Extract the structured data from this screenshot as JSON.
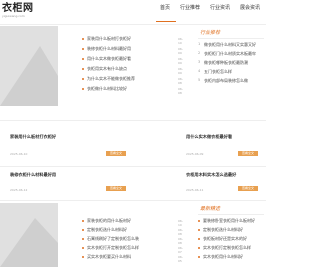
{
  "header": {
    "logo": "衣柜网",
    "logo_sub": "yiguiwang.com",
    "nav": [
      "首页",
      "行业推荐",
      "行业资讯",
      "展会资讯"
    ]
  },
  "top_list": {
    "items": [
      {
        "title": "家装用什么板材打衣柜好",
        "date": "06-10"
      },
      {
        "title": "装修衣柜什么材料最好用",
        "date": "06-09"
      },
      {
        "title": "用什么实木做衣柜最好看",
        "date": "06-09"
      },
      {
        "title": "衣柜用实木有什么缺点",
        "date": "06-09"
      },
      {
        "title": "为什么实木不能做衣柜推荐",
        "date": "06-08"
      },
      {
        "title": "衣柜做什么材料比较好",
        "date": "06-08"
      }
    ]
  },
  "sidebar_top": {
    "heading": "行业推荐",
    "items": [
      {
        "num": "1",
        "title": "做衣柜用什么材料又实惠又好"
      },
      {
        "num": "2",
        "title": "衣柜柜门什么材质实木板最牢"
      },
      {
        "num": "3",
        "title": "做衣柜哪种板衣柜最防潮"
      },
      {
        "num": "4",
        "title": "五门衣柜怎么样"
      },
      {
        "num": "5",
        "title": "衣柜内部布局装修怎么做"
      }
    ]
  },
  "cards": [
    {
      "title": "家装用什么板材打衣柜好",
      "date": "2025-06-10",
      "btn": "查看全文"
    },
    {
      "title": "用什么实木做衣柜最好看",
      "date": "2025-06-09",
      "btn": "查看全文"
    },
    {
      "title": "装修衣柜什么材料最好用",
      "date": "2025-06-12",
      "btn": "查看全文"
    },
    {
      "title": "衣柜用木料实木怎么选最好",
      "date": "2025-06-11",
      "btn": "查看全文"
    }
  ],
  "sidebar_bottom": {
    "heading": "最新精选",
    "items": [
      {
        "title": "要装修卧室衣柜用什么板材好"
      },
      {
        "title": "定制衣柜选什么材料好"
      },
      {
        "title": "衣柜板材好还是实木的好"
      },
      {
        "title": "实木衣柜打定制衣柜怎么样"
      },
      {
        "title": "实木衣柜用什么材料好"
      }
    ]
  },
  "bottom_list": {
    "items": [
      {
        "title": "家装衣柜的用什么板材好",
        "date": "06-10"
      },
      {
        "title": "定制衣柜选什么材料好",
        "date": "06-08"
      },
      {
        "title": "石膏线刷好了定制衣柜怎么装",
        "date": "06-08"
      },
      {
        "title": "实木衣柜打开定制衣柜怎么样",
        "date": "06-07"
      },
      {
        "title": "买实木衣柜要买什么材料",
        "date": "06-05"
      }
    ]
  }
}
